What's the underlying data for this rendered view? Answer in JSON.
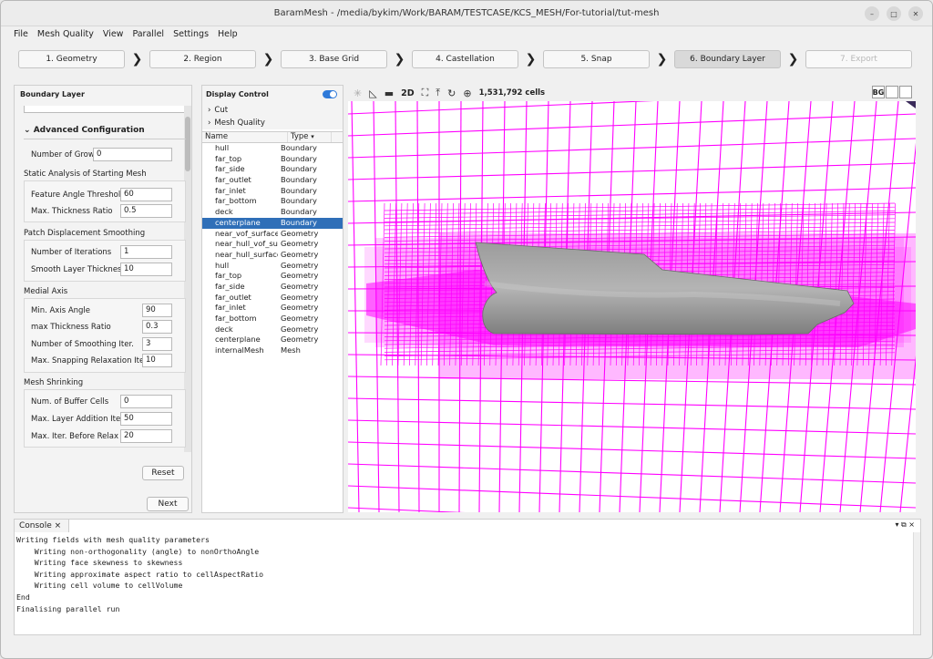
{
  "window": {
    "title": "BaramMesh - /media/bykim/Work/BARAM/TESTCASE/KCS_MESH/For-tutorial/tut-mesh"
  },
  "menu": [
    "File",
    "Mesh Quality",
    "View",
    "Parallel",
    "Settings",
    "Help"
  ],
  "steps": [
    {
      "label": "1. Geometry",
      "state": "normal"
    },
    {
      "label": "2. Region",
      "state": "normal"
    },
    {
      "label": "3. Base Grid",
      "state": "normal"
    },
    {
      "label": "4. Castellation",
      "state": "normal"
    },
    {
      "label": "5. Snap",
      "state": "normal"
    },
    {
      "label": "6. Boundary Layer",
      "state": "active"
    },
    {
      "label": "7. Export",
      "state": "disabled"
    }
  ],
  "left": {
    "title": "Boundary Layer",
    "advanced": "Advanced Configuration",
    "num_grow_label": "Number of Grow",
    "num_grow": "0",
    "static_group": "Static Analysis of Starting Mesh",
    "feature_angle_label": "Feature Angle Threshold",
    "feature_angle": "60",
    "max_thick_label": "Max. Thickness Ratio",
    "max_thick": "0.5",
    "patch_group": "Patch Displacement Smoothing",
    "num_iter_label": "Number of Iterations",
    "num_iter": "1",
    "smooth_layer_label": "Smooth Layer Thickness",
    "smooth_layer": "10",
    "medial_group": "Medial Axis",
    "min_axis_label": "Min. Axis Angle",
    "min_axis": "90",
    "max_thick2_label": "max Thickness Ratio",
    "max_thick2": "0.3",
    "num_smooth_label": "Number of Smoothing Iter.",
    "num_smooth": "3",
    "max_snap_label": "Max. Snapping Relaxation Iter.",
    "max_snap": "10",
    "shrink_group": "Mesh Shrinking",
    "buffer_label": "Num. of Buffer Cells",
    "buffer": "0",
    "max_layer_label": "Max. Layer Addition Iter.",
    "max_layer": "50",
    "max_relax_label": "Max. Iter. Before Relax",
    "max_relax": "20",
    "reset": "Reset",
    "next": "Next"
  },
  "display": {
    "title": "Display Control",
    "cut": "Cut",
    "mesh_quality": "Mesh Quality",
    "col_name": "Name",
    "col_type": "Type",
    "rows": [
      {
        "name": "hull",
        "type": "Boundary"
      },
      {
        "name": "far_top",
        "type": "Boundary"
      },
      {
        "name": "far_side",
        "type": "Boundary"
      },
      {
        "name": "far_outlet",
        "type": "Boundary"
      },
      {
        "name": "far_inlet",
        "type": "Boundary"
      },
      {
        "name": "far_bottom",
        "type": "Boundary"
      },
      {
        "name": "deck",
        "type": "Boundary"
      },
      {
        "name": "centerplane",
        "type": "Boundary"
      },
      {
        "name": "near_vof_surface",
        "type": "Geometry"
      },
      {
        "name": "near_hull_vof_sur...",
        "type": "Geometry"
      },
      {
        "name": "near_hull_surface",
        "type": "Geometry"
      },
      {
        "name": "hull",
        "type": "Geometry"
      },
      {
        "name": "far_top",
        "type": "Geometry"
      },
      {
        "name": "far_side",
        "type": "Geometry"
      },
      {
        "name": "far_outlet",
        "type": "Geometry"
      },
      {
        "name": "far_inlet",
        "type": "Geometry"
      },
      {
        "name": "far_bottom",
        "type": "Geometry"
      },
      {
        "name": "deck",
        "type": "Geometry"
      },
      {
        "name": "centerplane",
        "type": "Geometry"
      },
      {
        "name": "internalMesh",
        "type": "Mesh"
      }
    ],
    "selected_index": 7
  },
  "viewer": {
    "cells": "1,531,792 cells",
    "mode_2d": "2D",
    "bg": "BG",
    "mesh_color": "#ff00ff"
  },
  "console": {
    "tab": "Console",
    "lines": [
      "Writing fields with mesh quality parameters",
      "    Writing non-orthogonality (angle) to nonOrthoAngle",
      "    Writing face skewness to skewness",
      "    Writing approximate aspect ratio to cellAspectRatio",
      "    Writing cell volume to cellVolume",
      "End",
      "Finalising parallel run"
    ]
  }
}
